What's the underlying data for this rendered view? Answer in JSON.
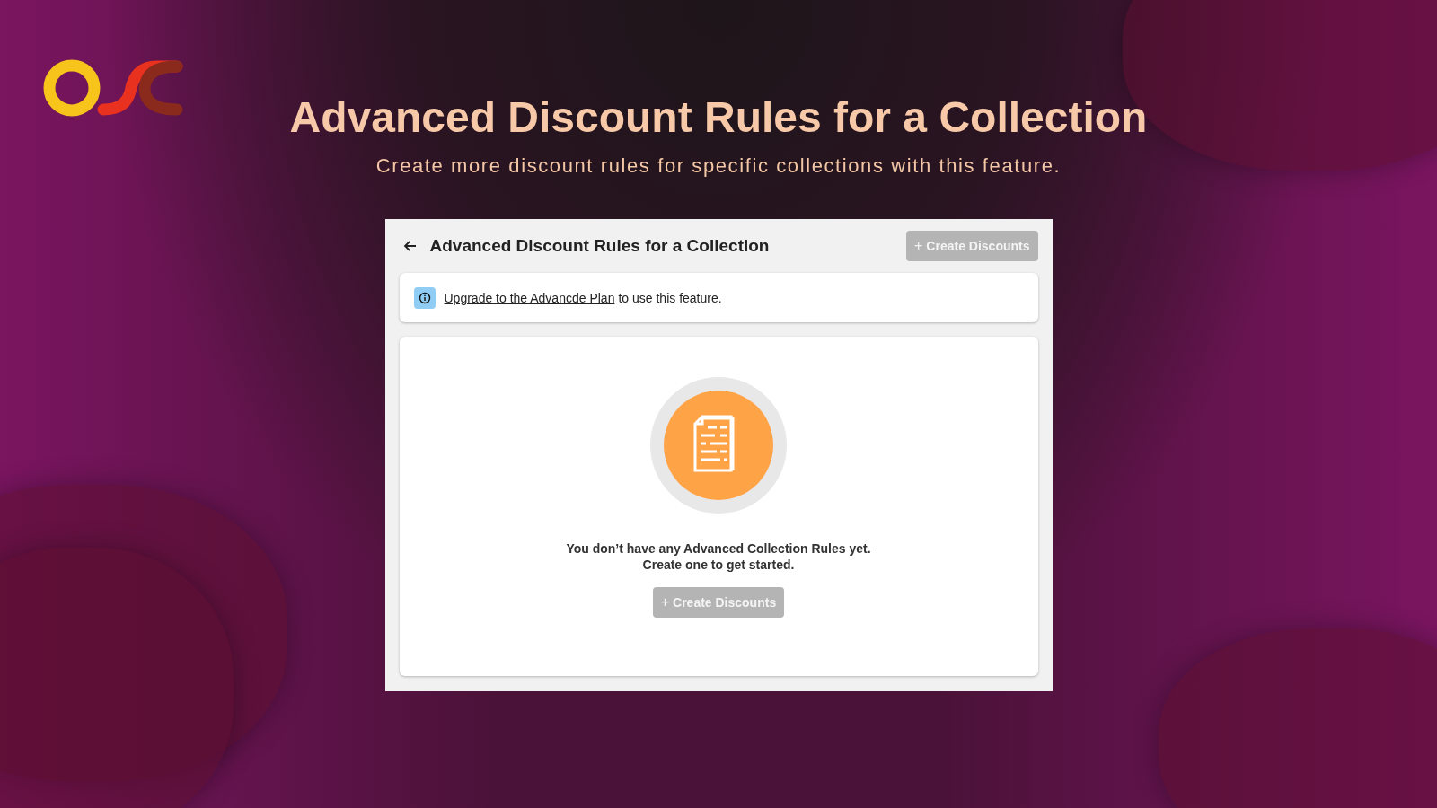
{
  "hero": {
    "title": "Advanced Discount Rules for a Collection",
    "subtitle": "Create more discount rules for specific collections with this feature."
  },
  "page": {
    "title": "Advanced Discount Rules for a Collection",
    "header_button": {
      "icon": "+",
      "label": "Create Discounts",
      "disabled": true
    },
    "banner": {
      "link": "Upgrade to the Advancde Plan",
      "text": "to use this feature."
    },
    "empty_state": {
      "lines": [
        "You don’t have any Advanced Collection Rules yet.",
        "Create one to get started."
      ],
      "button": {
        "icon": "+",
        "label": "Create Discounts",
        "disabled": true
      }
    }
  }
}
